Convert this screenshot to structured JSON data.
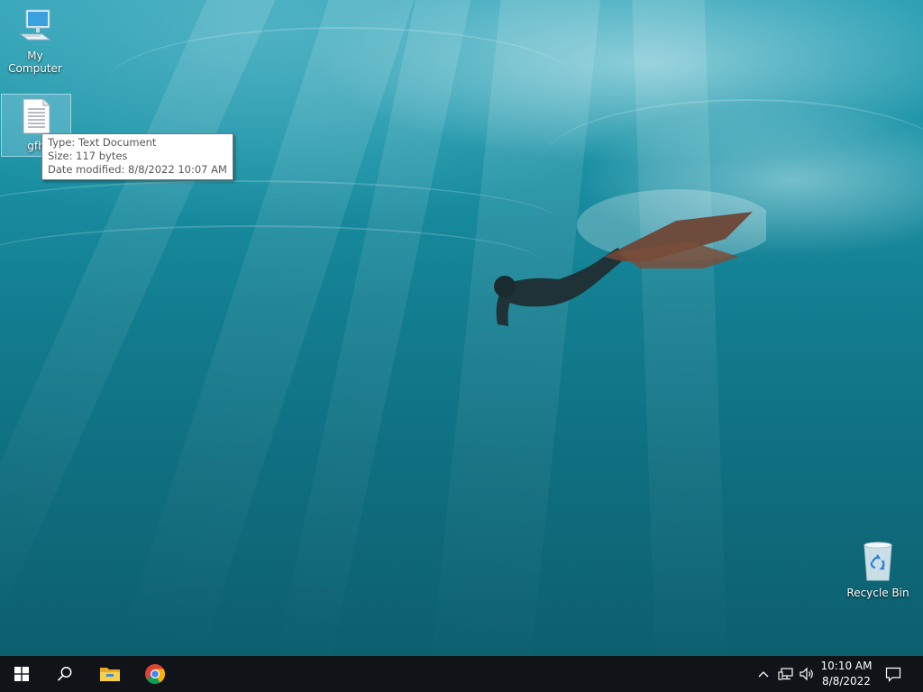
{
  "desktop": {
    "icons": [
      {
        "label": "My Computer",
        "icon": "computer-icon"
      },
      {
        "label": "gfh",
        "icon": "text-document-icon"
      },
      {
        "label": "Recycle Bin",
        "icon": "recycle-bin-icon"
      }
    ]
  },
  "tooltip": {
    "type": "Type: Text Document",
    "size": "Size: 117 bytes",
    "modified": "Date modified: 8/8/2022 10:07 AM"
  },
  "taskbar": {
    "start": "windows-start-icon",
    "search": "search-icon",
    "pinned": [
      "file-explorer-icon",
      "chrome-icon"
    ],
    "tray": [
      "chevron-up-icon",
      "network-icon",
      "volume-icon"
    ],
    "time": "10:10 AM",
    "date": "8/8/2022",
    "notifications": "action-center-icon"
  },
  "colors": {
    "taskbar": "#101418",
    "water_top": "#2fa2b6",
    "water_bottom": "#0c5f6e"
  }
}
